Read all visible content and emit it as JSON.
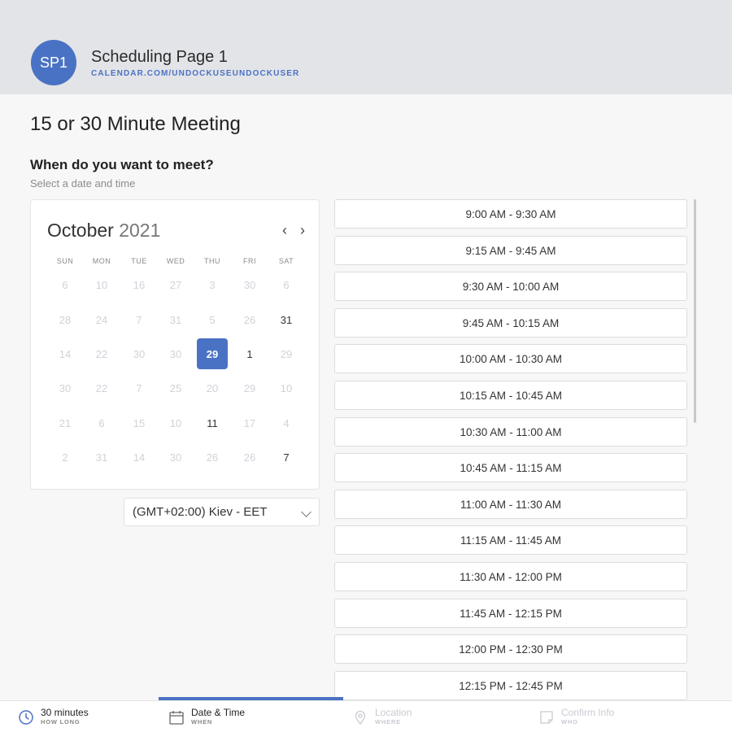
{
  "header": {
    "avatar_initials": "SP1",
    "page_name": "Scheduling Page 1",
    "page_url": "CALENDAR.COM/UNDOCKUSEUNDOCKUSER"
  },
  "meeting": {
    "title": "15 or 30 Minute Meeting",
    "question": "When do you want to meet?",
    "subtitle": "Select a date and time"
  },
  "calendar": {
    "month": "October",
    "year": "2021",
    "weekdays": [
      "SUN",
      "MON",
      "TUE",
      "WED",
      "THU",
      "FRI",
      "SAT"
    ],
    "selected_day": "29",
    "weeks": [
      [
        "6",
        "10",
        "16",
        "27",
        "3",
        "30",
        "6"
      ],
      [
        "28",
        "24",
        "7",
        "31",
        "5",
        "26",
        "31"
      ],
      [
        "14",
        "22",
        "30",
        "30",
        "29",
        "1",
        "29"
      ],
      [
        "30",
        "22",
        "7",
        "25",
        "20",
        "29",
        "10"
      ],
      [
        "21",
        "6",
        "15",
        "10",
        "11",
        "17",
        "4"
      ],
      [
        "2",
        "31",
        "14",
        "30",
        "26",
        "26",
        "7"
      ]
    ],
    "available": [
      [
        1,
        6
      ],
      [
        2,
        5
      ],
      [
        4,
        4
      ],
      [
        5,
        6
      ]
    ],
    "selected": [
      2,
      4
    ]
  },
  "timezone": {
    "value": "(GMT+02:00) Kiev - EET"
  },
  "time_slots": [
    "9:00 AM - 9:30 AM",
    "9:15 AM - 9:45 AM",
    "9:30 AM - 10:00 AM",
    "9:45 AM - 10:15 AM",
    "10:00 AM - 10:30 AM",
    "10:15 AM - 10:45 AM",
    "10:30 AM - 11:00 AM",
    "10:45 AM - 11:15 AM",
    "11:00 AM - 11:30 AM",
    "11:15 AM - 11:45 AM",
    "11:30 AM - 12:00 PM",
    "11:45 AM - 12:15 PM",
    "12:00 PM - 12:30 PM",
    "12:15 PM - 12:45 PM"
  ],
  "footer": {
    "steps": [
      {
        "label": "30 minutes",
        "sub": "HOW LONG",
        "icon": "clock-icon"
      },
      {
        "label": "Date & Time",
        "sub": "WHEN",
        "icon": "calendar-icon"
      },
      {
        "label": "Location",
        "sub": "WHERE",
        "icon": "location-pin-icon"
      },
      {
        "label": "Confirm Info",
        "sub": "WHO",
        "icon": "note-icon"
      }
    ]
  },
  "colors": {
    "accent": "#4a72c4",
    "header_bg": "#e3e4e8",
    "page_bg": "#f7f7f7",
    "unavailable_day": "#d0d2d8"
  }
}
